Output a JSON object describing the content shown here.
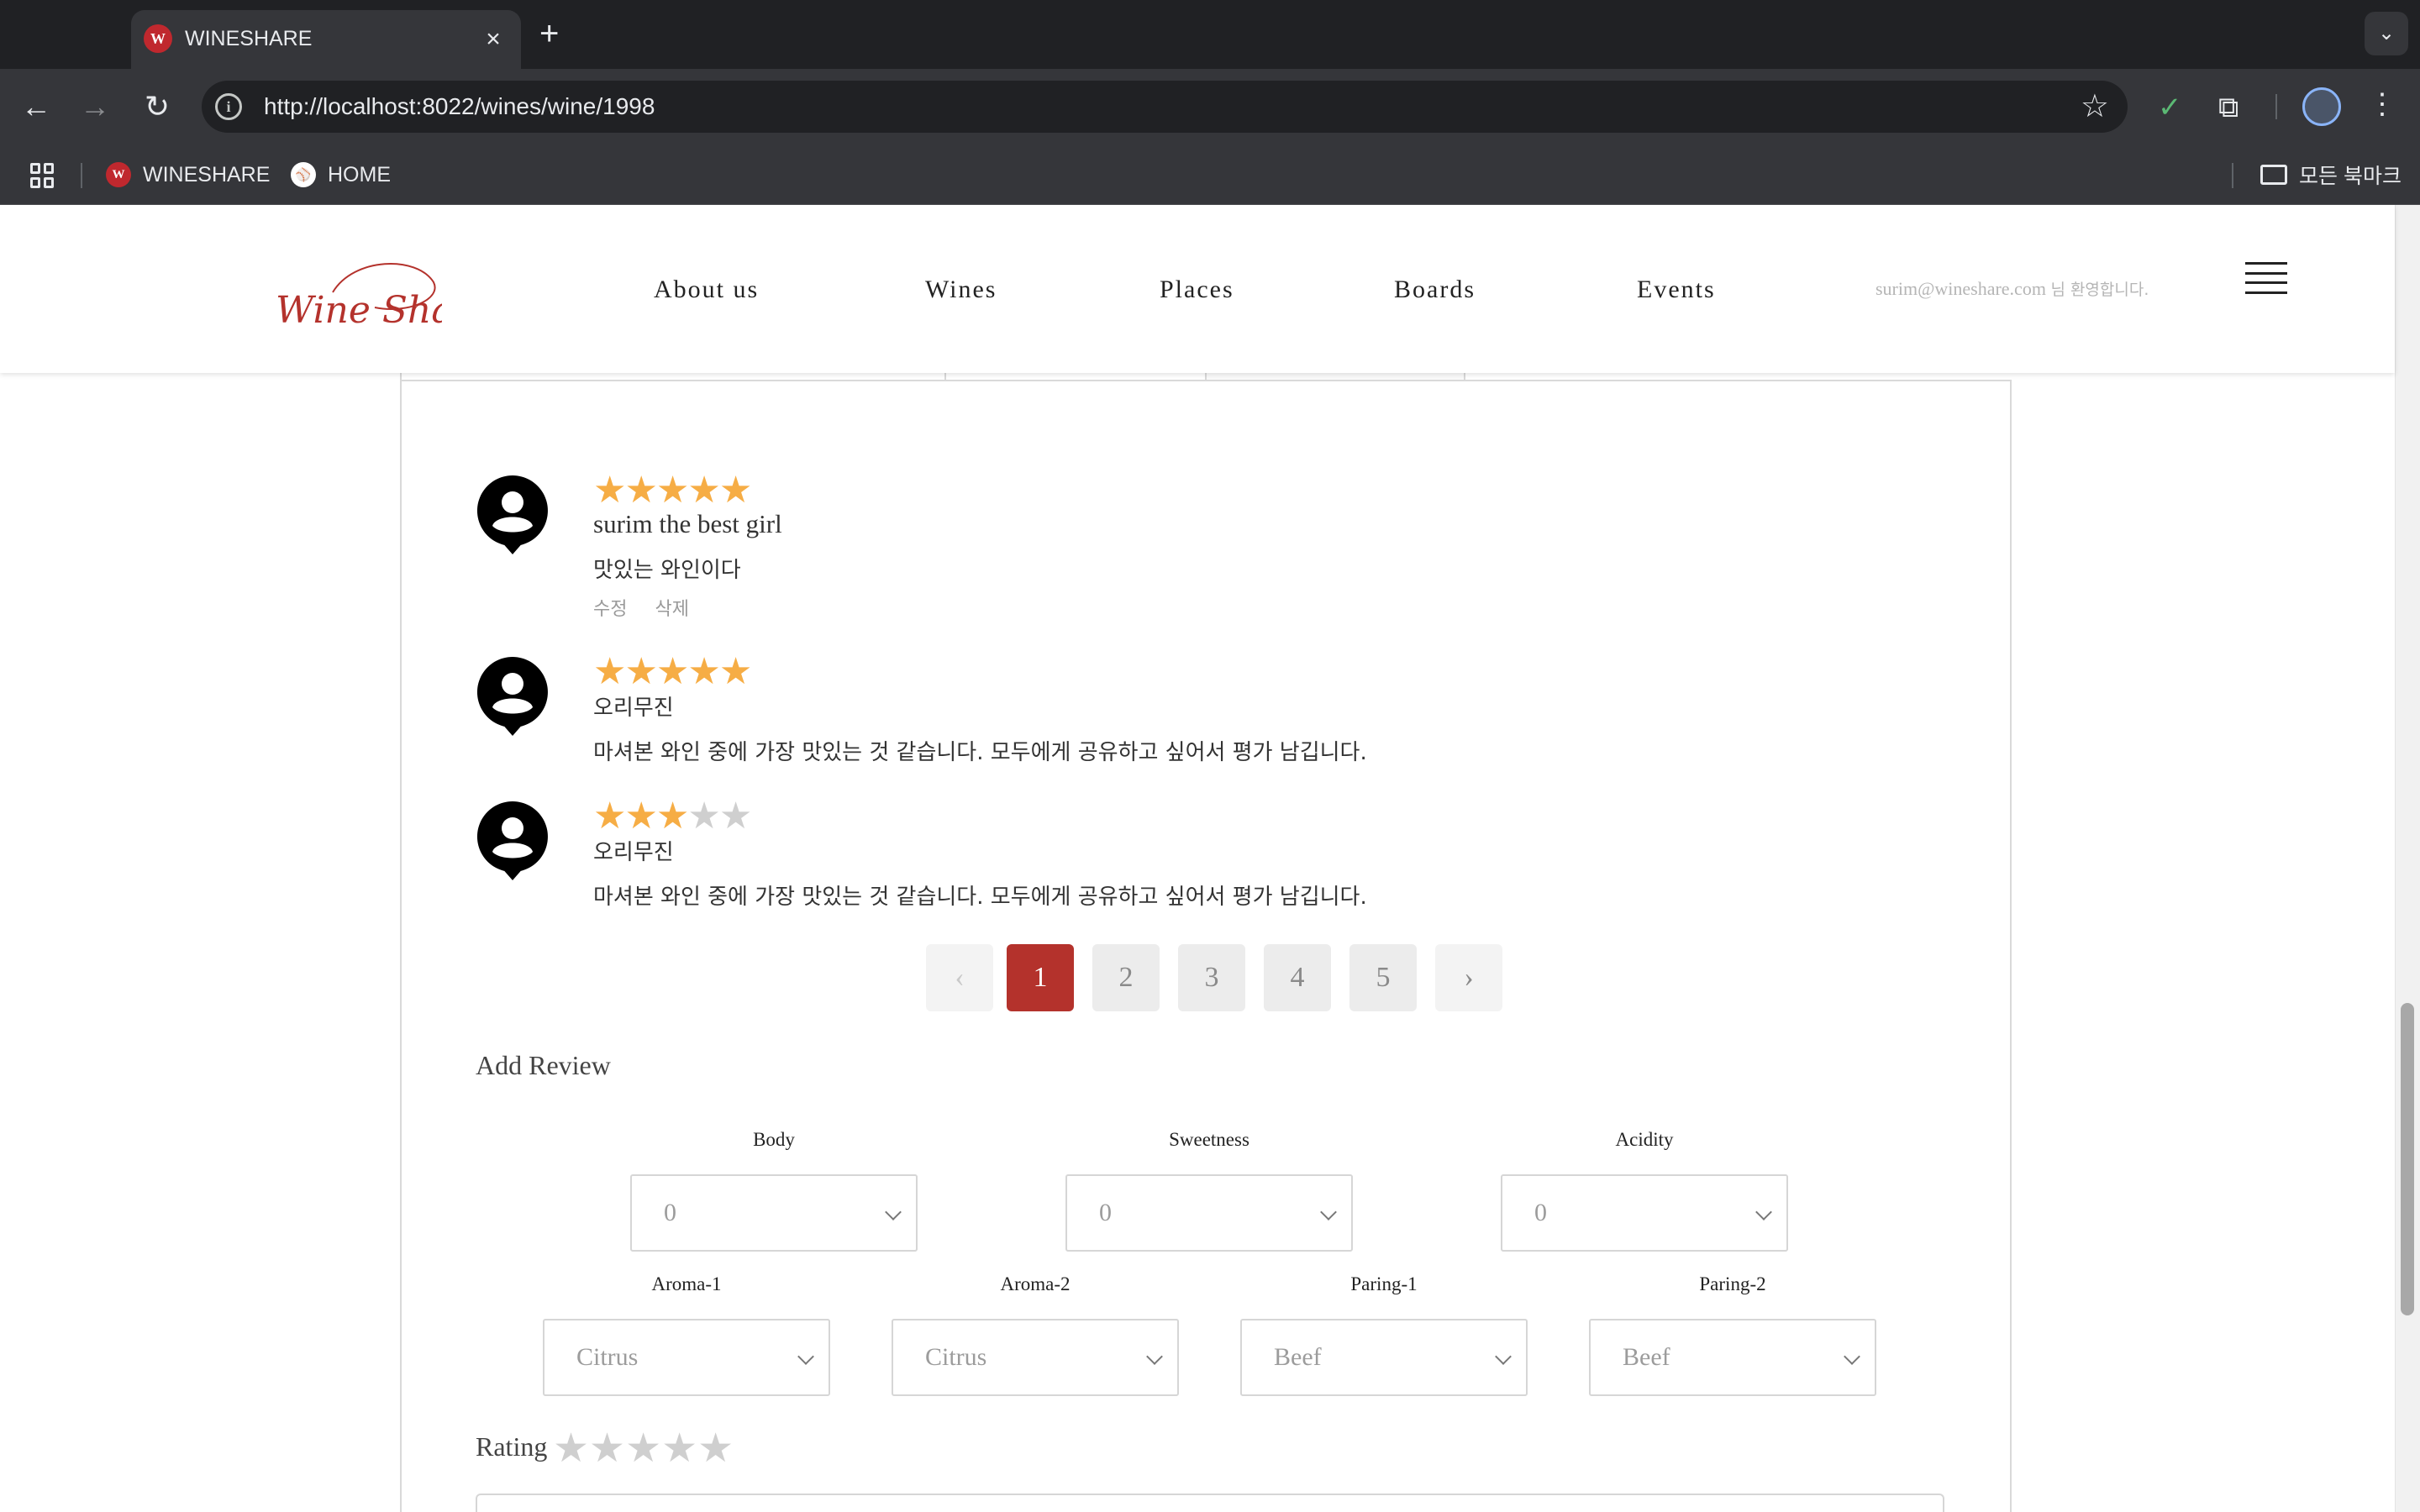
{
  "browser": {
    "tab_title": "WINESHARE",
    "tab_favicon": "W",
    "url": "http://localhost:8022/wines/wine/1998",
    "bookmarks": [
      {
        "label": "WINESHARE",
        "icon": "W"
      },
      {
        "label": "HOME",
        "icon": "⚾"
      }
    ],
    "all_bookmarks_label": "모든 북마크"
  },
  "header": {
    "logo_text": "Wine Share",
    "nav": [
      "About us",
      "Wines",
      "Places",
      "Boards",
      "Events"
    ],
    "user_email": "surim@wineshare.com",
    "welcome_suffix": "님 환영합니다."
  },
  "reviews": [
    {
      "rating": 5,
      "name": "surim the best girl",
      "text": "맛있는 와인이다",
      "actions": [
        "수정",
        "삭제"
      ]
    },
    {
      "rating": 5,
      "name": "오리무진",
      "text": "마셔본 와인 중에 가장 맛있는 것 같습니다. 모두에게 공유하고 싶어서 평가 남깁니다."
    },
    {
      "rating": 3,
      "name": "오리무진",
      "text": "마셔본 와인 중에 가장 맛있는 것 같습니다. 모두에게 공유하고 싶어서 평가 남깁니다."
    }
  ],
  "pagination": {
    "prev": "‹",
    "next": "›",
    "pages": [
      "1",
      "2",
      "3",
      "4",
      "5"
    ],
    "current": "1"
  },
  "add_review": {
    "title": "Add Review",
    "fields_row1": [
      {
        "label": "Body",
        "value": "0"
      },
      {
        "label": "Sweetness",
        "value": "0"
      },
      {
        "label": "Acidity",
        "value": "0"
      }
    ],
    "fields_row2": [
      {
        "label": "Aroma-1",
        "value": "Citrus"
      },
      {
        "label": "Aroma-2",
        "value": "Citrus"
      },
      {
        "label": "Paring-1",
        "value": "Beef"
      },
      {
        "label": "Paring-2",
        "value": "Beef"
      }
    ],
    "rating_label": "Rating",
    "rating_value": 0,
    "rating_max": 5
  },
  "colors": {
    "accent": "#b4322c",
    "star_on": "#f6ad45",
    "star_off": "#cfcfcf"
  }
}
